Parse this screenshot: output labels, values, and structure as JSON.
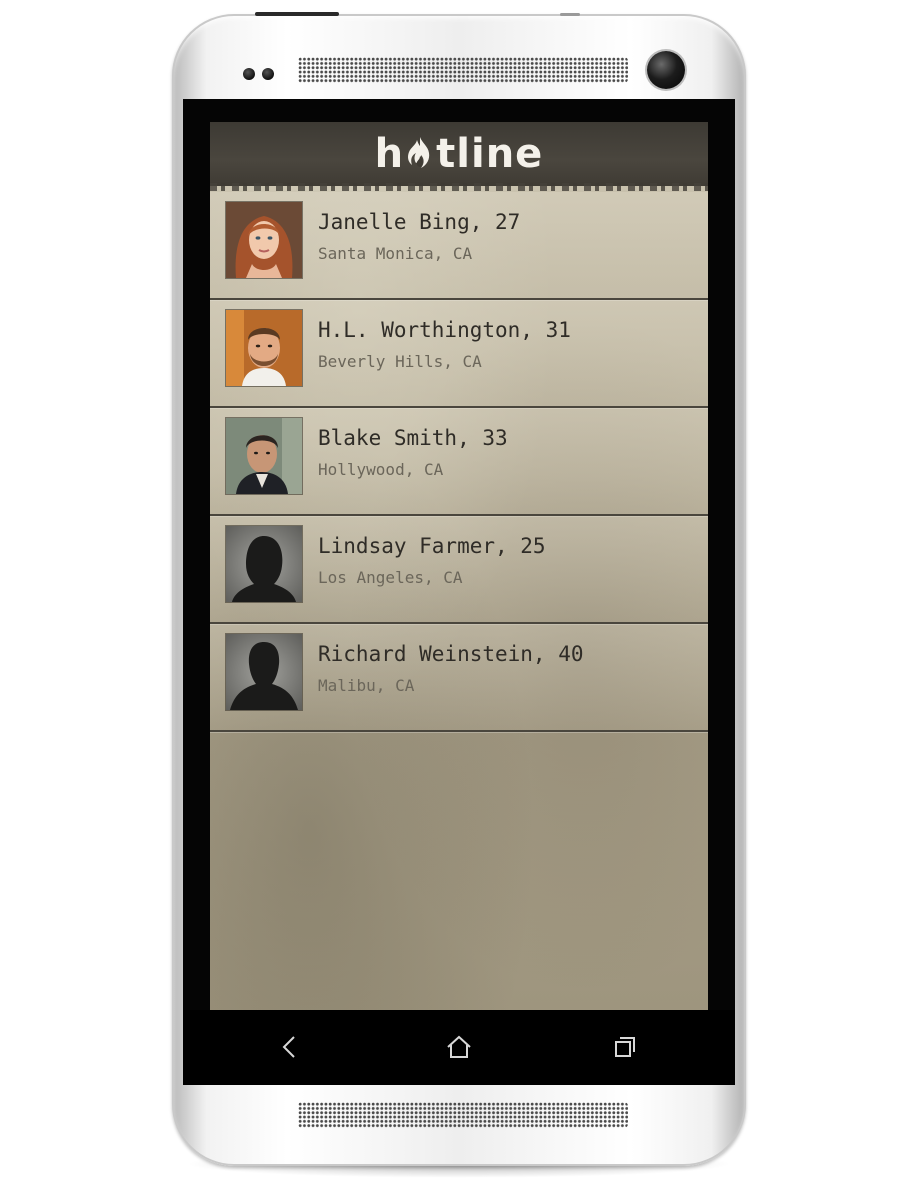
{
  "app": {
    "logo_text_left": "h",
    "logo_text_right": "tline",
    "logo_icon": "flame-icon"
  },
  "contacts": [
    {
      "name": "Janelle Bing, 27",
      "location": "Santa Monica, CA",
      "avatar": "photo-woman-red-hair"
    },
    {
      "name": "H.L. Worthington, 31",
      "location": "Beverly Hills, CA",
      "avatar": "photo-man-beard"
    },
    {
      "name": "Blake Smith, 33",
      "location": "Hollywood, CA",
      "avatar": "photo-man-dark-hair"
    },
    {
      "name": "Lindsay Farmer, 25",
      "location": "Los Angeles, CA",
      "avatar": "silhouette-placeholder"
    },
    {
      "name": "Richard Weinstein, 40",
      "location": "Malibu, CA",
      "avatar": "silhouette-placeholder"
    }
  ],
  "navbar": {
    "back_icon": "back-chevron-icon",
    "home_icon": "home-icon",
    "recent_icon": "recent-apps-icon"
  },
  "colors": {
    "header": "#3d3a34",
    "paper": "#c4bca6",
    "name_text": "#2f2c27",
    "location_text": "#6b665a"
  }
}
